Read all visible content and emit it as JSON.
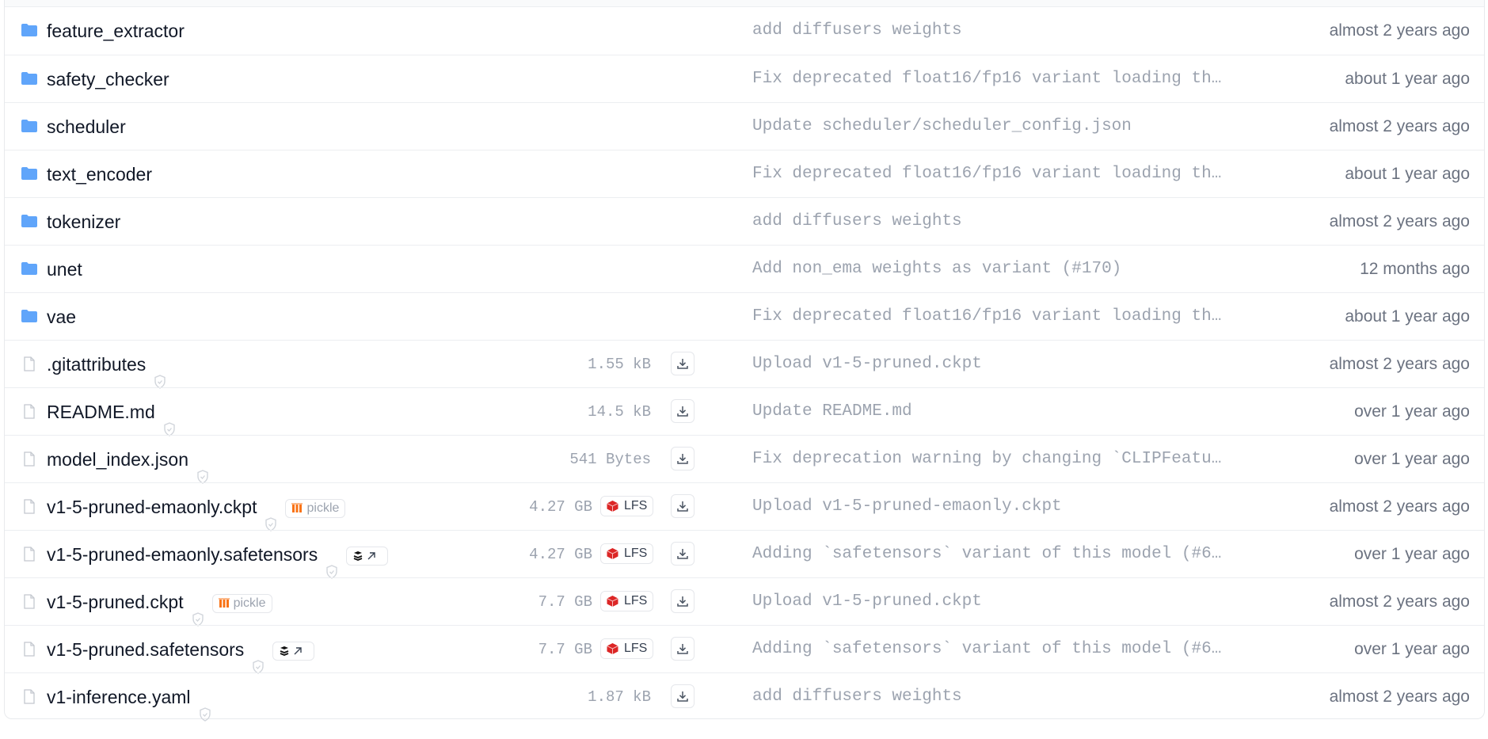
{
  "rows": [
    {
      "type": "folder",
      "name": "feature_extractor",
      "commit": "add diffusers weights",
      "date": "almost 2 years ago"
    },
    {
      "type": "folder",
      "name": "safety_checker",
      "commit": "Fix deprecated float16/fp16 variant loading th…",
      "date": "about 1 year ago"
    },
    {
      "type": "folder",
      "name": "scheduler",
      "commit": "Update scheduler/scheduler_config.json",
      "date": "almost 2 years ago"
    },
    {
      "type": "folder",
      "name": "text_encoder",
      "commit": "Fix deprecated float16/fp16 variant loading th…",
      "date": "about 1 year ago"
    },
    {
      "type": "folder",
      "name": "tokenizer",
      "commit": "add diffusers weights",
      "date": "almost 2 years ago"
    },
    {
      "type": "folder",
      "name": "unet",
      "commit": "Add non_ema weights as variant (#170)",
      "date": "12 months ago"
    },
    {
      "type": "folder",
      "name": "vae",
      "commit": "Fix deprecated float16/fp16 variant loading th…",
      "date": "about 1 year ago"
    },
    {
      "type": "file",
      "name": ".gitattributes",
      "size": "1.55 kB",
      "commit": "Upload v1-5-pruned.ckpt",
      "date": "almost 2 years ago"
    },
    {
      "type": "file",
      "name": "README.md",
      "size": "14.5 kB",
      "commit": "Update README.md",
      "date": "over 1 year ago"
    },
    {
      "type": "file",
      "name": "model_index.json",
      "size": "541 Bytes",
      "commit": "Fix deprecation warning by changing `CLIPFeatu…",
      "date": "over 1 year ago"
    },
    {
      "type": "file",
      "name": "v1-5-pruned-emaonly.ckpt",
      "tag": "pickle",
      "size": "4.27 GB",
      "lfs": "LFS",
      "commit": "Upload v1-5-pruned-emaonly.ckpt",
      "date": "almost 2 years ago"
    },
    {
      "type": "file",
      "name": "v1-5-pruned-emaonly.safetensors",
      "tag": "safetensors",
      "size": "4.27 GB",
      "lfs": "LFS",
      "commit": "Adding `safetensors` variant of this model (#6…",
      "date": "over 1 year ago"
    },
    {
      "type": "file",
      "name": "v1-5-pruned.ckpt",
      "tag": "pickle",
      "size": "7.7 GB",
      "lfs": "LFS",
      "commit": "Upload v1-5-pruned.ckpt",
      "date": "almost 2 years ago"
    },
    {
      "type": "file",
      "name": "v1-5-pruned.safetensors",
      "tag": "safetensors",
      "size": "7.7 GB",
      "lfs": "LFS",
      "commit": "Adding `safetensors` variant of this model (#6…",
      "date": "over 1 year ago"
    },
    {
      "type": "file",
      "name": "v1-inference.yaml",
      "size": "1.87 kB",
      "commit": "add diffusers weights",
      "date": "almost 2 years ago"
    }
  ],
  "colors": {
    "folder": "#60a5fa",
    "pickle": "#f97316",
    "lfs": "#dc2626"
  }
}
